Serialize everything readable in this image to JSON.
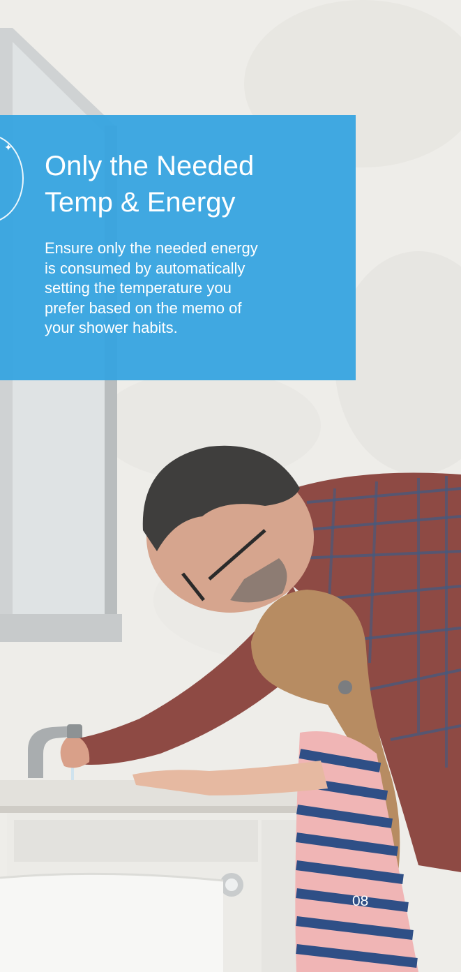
{
  "feature": {
    "title_line1": "Only the Needed",
    "title_line2": "Temp & Energy",
    "description_lines": [
      "Ensure only the needed energy",
      "is consumed by automatically",
      "setting the temperature you",
      "prefer based on the memo of",
      "your shower habits."
    ],
    "icon": "energy-icon"
  },
  "page_number": "08",
  "colors": {
    "card": "#35a4e0",
    "text": "#ffffff"
  }
}
